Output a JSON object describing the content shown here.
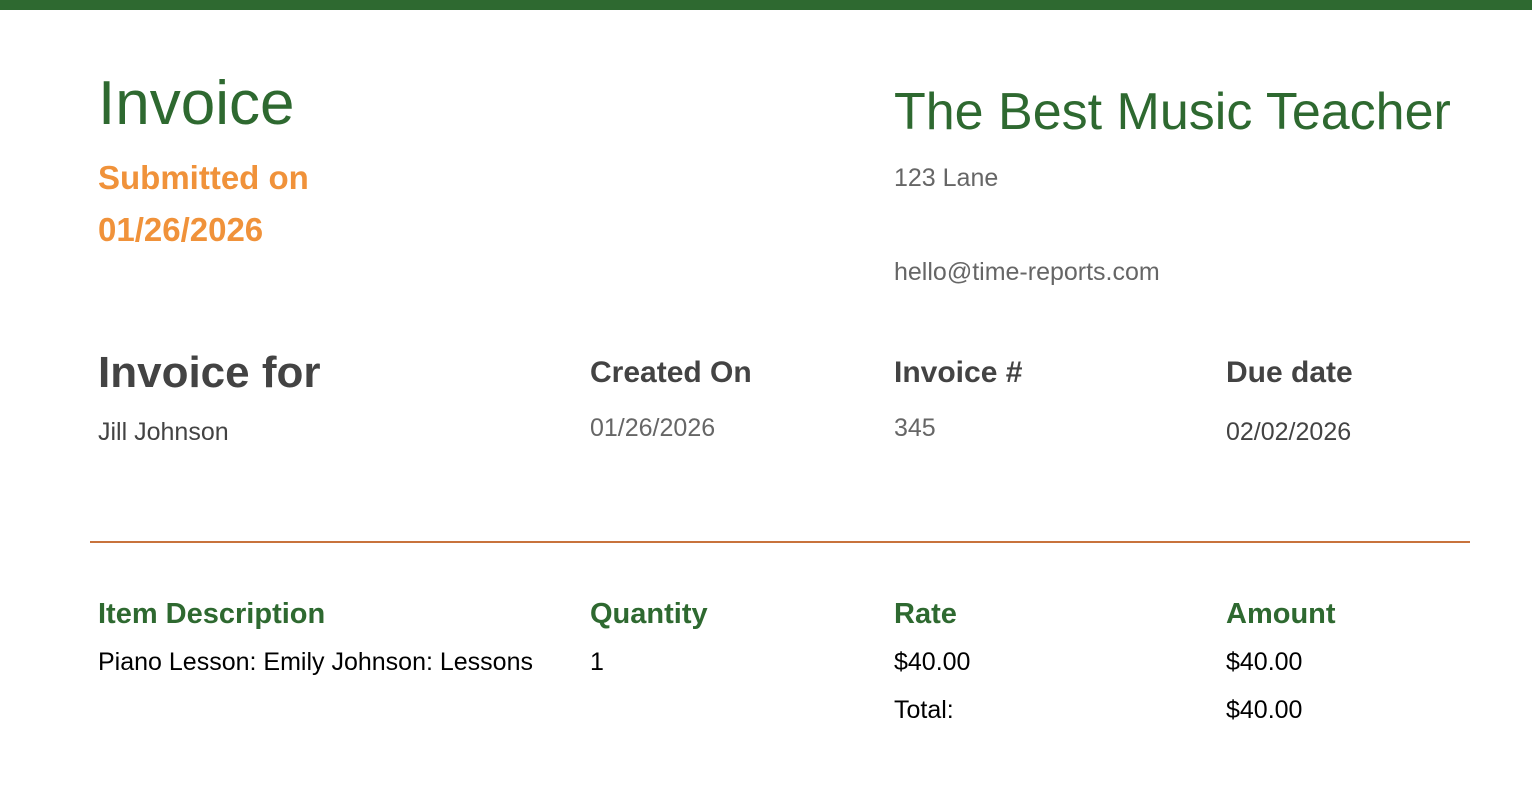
{
  "header": {
    "title": "Invoice",
    "submitted": "Submitted on 01/26/2026"
  },
  "company": {
    "name": "The Best Music Teacher",
    "address": "123 Lane",
    "email": "hello@time-reports.com"
  },
  "billing": {
    "invoice_for_label": "Invoice for",
    "client_name": "Jill Johnson",
    "created_on_label": "Created On",
    "created_on": "01/26/2026",
    "invoice_number_label": "Invoice #",
    "invoice_number": "345",
    "due_date_label": "Due date",
    "due_date": "02/02/2026"
  },
  "table": {
    "columns": [
      "Item Description",
      "Quantity",
      "Rate",
      "Amount"
    ],
    "rows": [
      [
        "Piano Lesson: Emily Johnson: Lessons",
        "1",
        "$40.00",
        "$40.00"
      ]
    ],
    "total_label": "Total:",
    "total_value": "$40.00"
  },
  "colors": {
    "brand_green": "#2e6930",
    "accent_orange": "#f0923a",
    "divider": "#c8733c"
  }
}
